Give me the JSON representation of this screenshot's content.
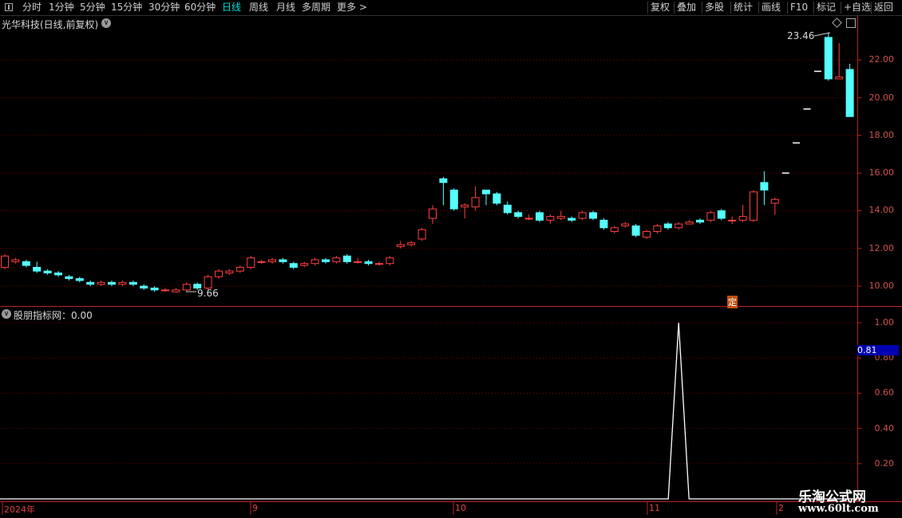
{
  "toolbar": {
    "left_items": [
      "分时",
      "1分钟",
      "5分钟",
      "15分钟",
      "30分钟",
      "60分钟",
      "日线",
      "周线",
      "月线",
      "多周期",
      "更多"
    ],
    "more_arrow": ">",
    "right_items": [
      "复权",
      "叠加",
      "多股",
      "统计",
      "画线",
      "F10",
      "标记",
      "+自选",
      "返回"
    ]
  },
  "main_panel": {
    "title": "光华科技(日线,前复权)",
    "high_label": "23.46",
    "low_label": "9.66",
    "marker": "定",
    "price_axis": [
      "22.00",
      "20.00",
      "18.00",
      "16.00",
      "14.00",
      "12.00",
      "10.00"
    ]
  },
  "indicator_panel": {
    "title": "股朋指标网：0.00",
    "axis": [
      "1.00",
      "0.80",
      "0.60",
      "0.40",
      "0.20"
    ],
    "crosshair_value": "0.81"
  },
  "date_axis": [
    "2024年",
    "9",
    "10",
    "11",
    "2"
  ],
  "watermark": {
    "line1": "乐淘公式网",
    "line2": "www.60lt.com"
  },
  "colors": {
    "up": "#ff4040",
    "down": "#54ffff",
    "grid": "#7a0000",
    "border": "#c02020"
  },
  "chart_data": {
    "type": "candlestick",
    "ylim": [
      9.2,
      24.0
    ],
    "candles": [
      [
        11.0,
        11.6,
        11.7,
        10.9
      ],
      [
        11.3,
        11.4,
        11.5,
        11.2
      ],
      [
        11.3,
        11.1,
        11.4,
        11.0
      ],
      [
        11.0,
        10.8,
        11.3,
        10.7
      ],
      [
        10.8,
        10.7,
        10.9,
        10.6
      ],
      [
        10.7,
        10.6,
        10.8,
        10.5
      ],
      [
        10.5,
        10.4,
        10.6,
        10.3
      ],
      [
        10.4,
        10.3,
        10.5,
        10.2
      ],
      [
        10.2,
        10.1,
        10.3,
        10.0
      ],
      [
        10.1,
        10.2,
        10.3,
        10.0
      ],
      [
        10.2,
        10.1,
        10.3,
        10.0
      ],
      [
        10.1,
        10.2,
        10.3,
        10.0
      ],
      [
        10.2,
        10.1,
        10.3,
        10.0
      ],
      [
        10.0,
        9.9,
        10.1,
        9.8
      ],
      [
        9.9,
        9.8,
        10.0,
        9.7
      ],
      [
        9.8,
        9.8,
        9.9,
        9.7
      ],
      [
        9.7,
        9.8,
        9.9,
        9.66
      ],
      [
        9.8,
        10.1,
        10.2,
        9.7
      ],
      [
        10.1,
        9.9,
        10.2,
        9.8
      ],
      [
        9.9,
        10.5,
        10.6,
        9.8
      ],
      [
        10.5,
        10.8,
        10.9,
        10.4
      ],
      [
        10.7,
        10.8,
        10.9,
        10.6
      ],
      [
        10.8,
        11.0,
        11.1,
        10.7
      ],
      [
        11.0,
        11.5,
        11.6,
        10.9
      ],
      [
        11.3,
        11.3,
        11.4,
        11.2
      ],
      [
        11.3,
        11.4,
        11.5,
        11.2
      ],
      [
        11.4,
        11.3,
        11.5,
        11.2
      ],
      [
        11.2,
        11.0,
        11.3,
        10.9
      ],
      [
        11.1,
        11.2,
        11.3,
        11.0
      ],
      [
        11.2,
        11.4,
        11.5,
        11.1
      ],
      [
        11.4,
        11.3,
        11.5,
        11.2
      ],
      [
        11.3,
        11.5,
        11.6,
        11.2
      ],
      [
        11.6,
        11.3,
        11.7,
        11.2
      ],
      [
        11.3,
        11.3,
        11.5,
        11.2
      ],
      [
        11.3,
        11.2,
        11.4,
        11.1
      ],
      [
        11.2,
        11.2,
        11.3,
        11.1
      ],
      [
        11.2,
        11.5,
        11.6,
        11.1
      ],
      [
        12.1,
        12.2,
        12.4,
        12.0
      ],
      [
        12.2,
        12.3,
        12.4,
        12.1
      ],
      [
        12.5,
        13.0,
        13.1,
        12.4
      ],
      [
        13.6,
        14.1,
        14.3,
        13.3
      ],
      [
        15.7,
        15.5,
        15.8,
        14.3
      ],
      [
        15.1,
        14.1,
        15.2,
        14.0
      ],
      [
        14.2,
        14.3,
        14.4,
        13.6
      ],
      [
        14.2,
        14.7,
        15.3,
        14.0
      ],
      [
        15.1,
        14.9,
        15.1,
        14.3
      ],
      [
        14.9,
        14.4,
        15.0,
        14.3
      ],
      [
        14.3,
        13.9,
        14.5,
        13.8
      ],
      [
        13.9,
        13.7,
        14.0,
        13.6
      ],
      [
        13.6,
        13.6,
        13.8,
        13.5
      ],
      [
        13.9,
        13.5,
        14.0,
        13.4
      ],
      [
        13.5,
        13.7,
        13.8,
        13.3
      ],
      [
        13.6,
        13.7,
        14.0,
        13.5
      ],
      [
        13.6,
        13.5,
        13.7,
        13.4
      ],
      [
        13.6,
        13.9,
        14.0,
        13.5
      ],
      [
        13.9,
        13.6,
        14.0,
        13.5
      ],
      [
        13.5,
        13.1,
        13.6,
        13.0
      ],
      [
        12.9,
        13.1,
        13.2,
        12.8
      ],
      [
        13.2,
        13.3,
        13.4,
        13.1
      ],
      [
        13.2,
        12.7,
        13.3,
        12.6
      ],
      [
        12.6,
        12.9,
        13.0,
        12.5
      ],
      [
        12.9,
        13.2,
        13.3,
        12.8
      ],
      [
        13.3,
        13.1,
        13.4,
        13.0
      ],
      [
        13.1,
        13.3,
        13.4,
        13.0
      ],
      [
        13.3,
        13.4,
        13.5,
        13.3
      ],
      [
        13.5,
        13.4,
        13.6,
        13.3
      ],
      [
        13.5,
        13.9,
        14.0,
        13.4
      ],
      [
        14.0,
        13.6,
        14.1,
        13.5
      ],
      [
        13.5,
        13.5,
        13.7,
        13.3
      ],
      [
        13.5,
        13.7,
        14.3,
        13.4
      ],
      [
        13.5,
        15.0,
        15.1,
        13.4
      ],
      [
        15.5,
        15.1,
        16.1,
        14.3
      ],
      [
        14.4,
        14.6,
        14.7,
        13.8
      ],
      [
        16.0,
        16.0,
        16.0,
        16.0
      ],
      [
        17.6,
        17.6,
        17.6,
        17.6
      ],
      [
        19.4,
        19.4,
        19.4,
        19.4
      ],
      [
        21.4,
        21.4,
        21.4,
        21.4
      ],
      [
        23.2,
        21.0,
        23.46,
        20.9
      ],
      [
        21.0,
        21.1,
        22.9,
        21.0
      ],
      [
        21.5,
        19.0,
        21.8,
        19.0
      ]
    ],
    "indicator": {
      "spike_at_index": 63,
      "spike_value": 1.0,
      "baseline": 0.0,
      "ylim": [
        0.0,
        1.0
      ]
    }
  }
}
